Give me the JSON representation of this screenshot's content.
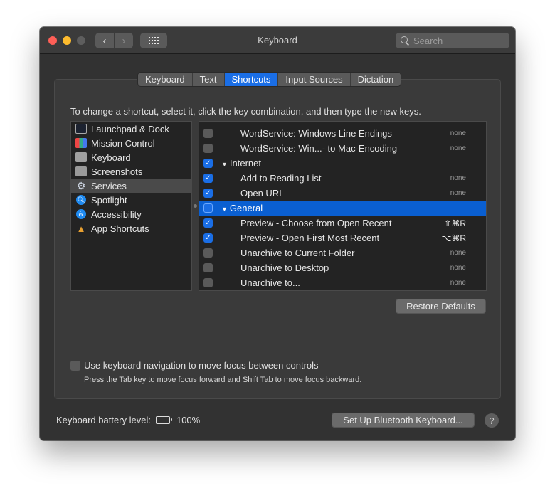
{
  "window": {
    "title": "Keyboard",
    "search_placeholder": "Search"
  },
  "nav": {
    "back_glyph": "‹",
    "forward_glyph": "›"
  },
  "tabs": [
    {
      "label": "Keyboard",
      "active": false
    },
    {
      "label": "Text",
      "active": false
    },
    {
      "label": "Shortcuts",
      "active": true
    },
    {
      "label": "Input Sources",
      "active": false
    },
    {
      "label": "Dictation",
      "active": false
    }
  ],
  "instructions": "To change a shortcut, select it, click the key combination, and then type the new keys.",
  "categories": [
    {
      "label": "Launchpad & Dock",
      "icon": "launchpad-icon",
      "glyph": "",
      "selected": false
    },
    {
      "label": "Mission Control",
      "icon": "mission-control-icon",
      "glyph": "",
      "selected": false
    },
    {
      "label": "Keyboard",
      "icon": "keyboard-icon",
      "glyph": "",
      "selected": false
    },
    {
      "label": "Screenshots",
      "icon": "screenshots-icon",
      "glyph": "",
      "selected": false
    },
    {
      "label": "Services",
      "icon": "gear-icon",
      "glyph": "⚙",
      "selected": true
    },
    {
      "label": "Spotlight",
      "icon": "spotlight-icon",
      "glyph": "🔍︎",
      "selected": false
    },
    {
      "label": "Accessibility",
      "icon": "accessibility-icon",
      "glyph": "♿︎",
      "selected": false
    },
    {
      "label": "App Shortcuts",
      "icon": "app-shortcuts-icon",
      "glyph": "▲",
      "selected": false
    }
  ],
  "services": [
    {
      "type": "item",
      "label": "WordService: Windows Line Endings",
      "checked": "off",
      "shortcut": "none",
      "selected": false
    },
    {
      "type": "item",
      "label": "WordService: Win...- to Mac-Encoding",
      "checked": "off",
      "shortcut": "none",
      "selected": false
    },
    {
      "type": "group",
      "label": "Internet",
      "checked": "on",
      "shortcut": "",
      "selected": false
    },
    {
      "type": "item",
      "label": "Add to Reading List",
      "checked": "on",
      "shortcut": "none",
      "selected": false
    },
    {
      "type": "item",
      "label": "Open URL",
      "checked": "on",
      "shortcut": "none",
      "selected": false
    },
    {
      "type": "group",
      "label": "General",
      "checked": "mixed",
      "shortcut": "",
      "selected": true
    },
    {
      "type": "item",
      "label": "Preview - Choose from Open Recent",
      "checked": "on",
      "shortcut": "⇧⌘R",
      "selected": false
    },
    {
      "type": "item",
      "label": "Preview - Open First Most Recent",
      "checked": "on",
      "shortcut": "⌥⌘R",
      "selected": false
    },
    {
      "type": "item",
      "label": "Unarchive to Current Folder",
      "checked": "off",
      "shortcut": "none",
      "selected": false
    },
    {
      "type": "item",
      "label": "Unarchive to Desktop",
      "checked": "off",
      "shortcut": "none",
      "selected": false
    },
    {
      "type": "item",
      "label": "Unarchive to...",
      "checked": "off",
      "shortcut": "none",
      "selected": false
    }
  ],
  "restore_defaults_label": "Restore Defaults",
  "keyboard_navigation": {
    "label": "Use keyboard navigation to move focus between controls",
    "checked": false,
    "help": "Press the Tab key to move focus forward and Shift Tab to move focus backward."
  },
  "battery": {
    "label": "Keyboard battery level:",
    "percent": "100%"
  },
  "bluetooth_button_label": "Set Up Bluetooth Keyboard...",
  "help_label": "?"
}
